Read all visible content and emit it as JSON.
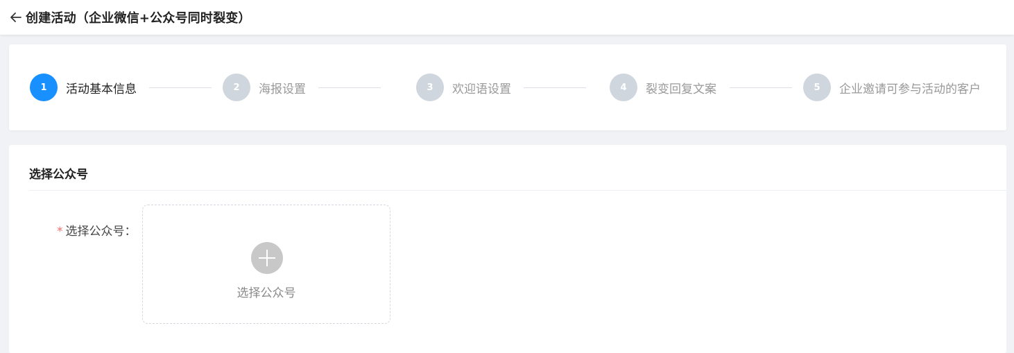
{
  "header": {
    "back_icon": "arrow-left-icon",
    "title": "创建活动（企业微信+公众号同时裂变）"
  },
  "steps": [
    {
      "number": "1",
      "label": "活动基本信息",
      "active": true
    },
    {
      "number": "2",
      "label": "海报设置",
      "active": false
    },
    {
      "number": "3",
      "label": "欢迎语设置",
      "active": false
    },
    {
      "number": "4",
      "label": "裂变回复文案",
      "active": false
    },
    {
      "number": "5",
      "label": "企业邀请可参与活动的客户",
      "active": false
    }
  ],
  "section": {
    "title": "选择公众号"
  },
  "form": {
    "required_mark": "*",
    "label": "选择公众号：",
    "upload_icon": "plus-circle-icon",
    "upload_text": "选择公众号"
  },
  "colors": {
    "accent": "#1890ff",
    "inactive_step": "#cfd6de",
    "required": "#f56c6c"
  }
}
